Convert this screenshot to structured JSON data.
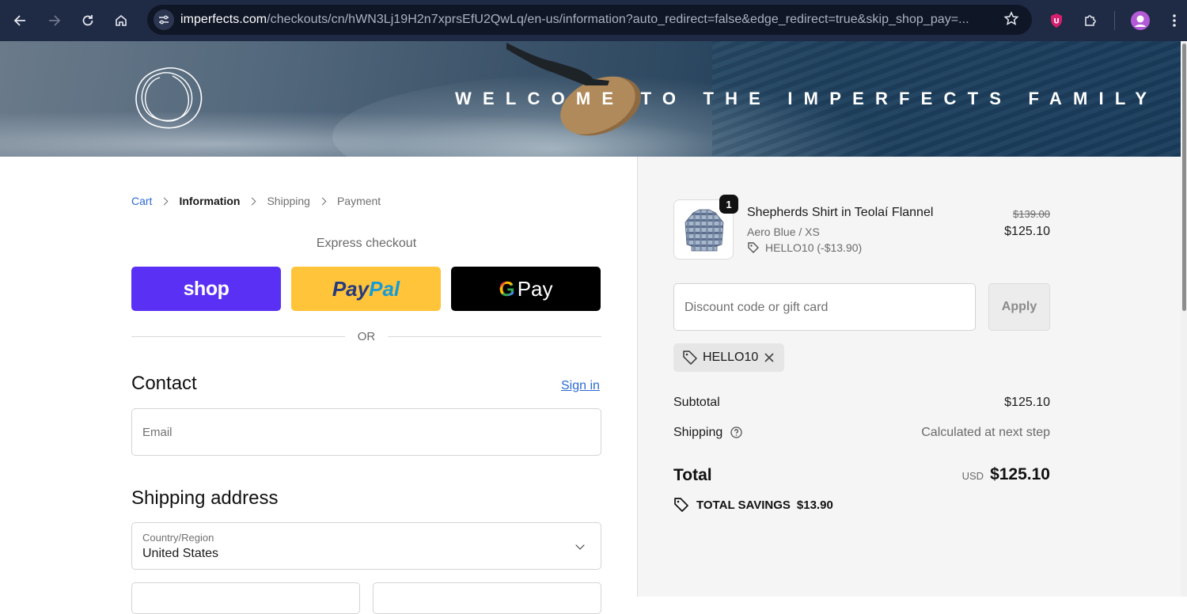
{
  "browser": {
    "url_host": "imperfects.com",
    "url_rest": "/checkouts/cn/hWN3Lj19H2n7xprsEfU2QwLq/en-us/information?auto_redirect=false&edge_redirect=true&skip_shop_pay=..."
  },
  "hero": {
    "welcome": "WELCOME TO THE IMPERFECTS FAMILY"
  },
  "breadcrumb": {
    "cart": "Cart",
    "information": "Information",
    "shipping": "Shipping",
    "payment": "Payment"
  },
  "express": {
    "heading": "Express checkout",
    "shop_label": "shop",
    "paypal_label_1": "Pay",
    "paypal_label_2": "Pal",
    "gpay_g": "G",
    "gpay_label": "Pay",
    "or_text": "OR"
  },
  "contact": {
    "title": "Contact",
    "signin": "Sign in",
    "email_placeholder": "Email"
  },
  "shipping_address": {
    "title": "Shipping address",
    "country_label": "Country/Region",
    "country_value": "United States"
  },
  "product": {
    "quantity": "1",
    "name": "Shepherds Shirt in Teolaí Flannel",
    "variant": "Aero Blue / XS",
    "discount": "HELLO10 (-$13.90)",
    "old_price": "$139.00",
    "price": "$125.10"
  },
  "discount": {
    "placeholder": "Discount code or gift card",
    "apply": "Apply",
    "applied_code": "HELLO10"
  },
  "totals": {
    "subtotal_label": "Subtotal",
    "subtotal_value": "$125.10",
    "shipping_label": "Shipping",
    "shipping_value": "Calculated at next step",
    "total_label": "Total",
    "currency": "USD",
    "total_value": "$125.10",
    "savings_label": "TOTAL SAVINGS",
    "savings_value": "$13.90"
  },
  "colors": {
    "shop": "#5a31f4",
    "paypal": "#ffc439",
    "gpay": "#000000",
    "link": "#2d6ad1",
    "chrome": "#1f2a44"
  }
}
